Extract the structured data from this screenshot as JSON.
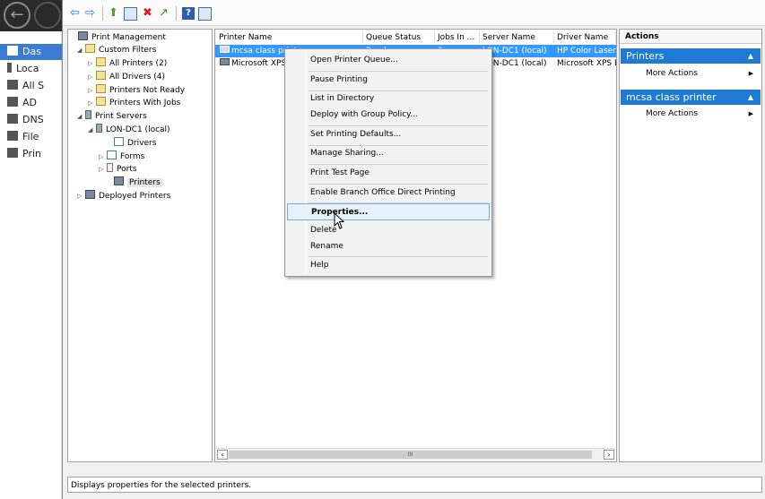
{
  "sm_nav": [
    "Das",
    "Loca",
    "All S",
    "AD",
    "DNS",
    "File",
    "Prin"
  ],
  "tree": [
    {
      "label": "Print Management",
      "exp": "",
      "icon": "printer"
    },
    {
      "label": "Custom Filters",
      "exp": "◢",
      "icon": "filter"
    },
    {
      "label": "All Printers (2)",
      "exp": "▷",
      "icon": "filter"
    },
    {
      "label": "All Drivers (4)",
      "exp": "▷",
      "icon": "filter"
    },
    {
      "label": "Printers Not Ready",
      "exp": "▷",
      "icon": "filter"
    },
    {
      "label": "Printers With Jobs",
      "exp": "▷",
      "icon": "filter"
    },
    {
      "label": "Print Servers",
      "exp": "◢",
      "icon": "server"
    },
    {
      "label": "LON-DC1 (local)",
      "exp": "◢",
      "icon": "server"
    },
    {
      "label": "Drivers",
      "exp": "",
      "icon": "drv"
    },
    {
      "label": "Forms",
      "exp": "▷",
      "icon": "drv"
    },
    {
      "label": "Ports",
      "exp": "▷",
      "icon": "port"
    },
    {
      "label": "Printers",
      "exp": "",
      "icon": "printer"
    },
    {
      "label": "Deployed Printers",
      "exp": "▷",
      "icon": "printer"
    }
  ],
  "list": {
    "columns": [
      "Printer Name",
      "Queue Status",
      "Jobs In ...",
      "Server Name",
      "Driver Name"
    ],
    "rows": [
      {
        "name": "mcsa class printer",
        "status": "Ready",
        "jobs": "0",
        "server": "LON-DC1 (local)",
        "driver": "HP Color Laser..."
      },
      {
        "name": "Microsoft XPS",
        "status": "",
        "jobs": "",
        "server": "LON-DC1 (local)",
        "driver": "Microsoft XPS D..."
      }
    ],
    "scroll_mark": "III"
  },
  "actions": {
    "title": "Actions",
    "groups": [
      {
        "header": "Printers",
        "item": "More Actions"
      },
      {
        "header": "mcsa class printer",
        "item": "More Actions"
      }
    ]
  },
  "context_menu": [
    "Open Printer Queue...",
    "Pause Printing",
    "List in Directory",
    "Deploy with Group Policy...",
    "Set Printing Defaults...",
    "Manage Sharing...",
    "Print Test Page",
    "Enable Branch Office Direct Printing",
    "Properties...",
    "Delete",
    "Rename",
    "Help"
  ],
  "status": "Displays properties for the selected printers."
}
